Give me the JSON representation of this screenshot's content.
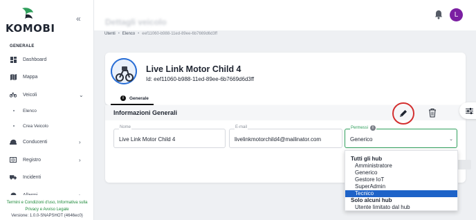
{
  "app": {
    "brand": "KOMOBI"
  },
  "sidebar": {
    "section_title": "GENERALE",
    "items": [
      {
        "label": "Dashboard",
        "icon": "dashboard-icon"
      },
      {
        "label": "Mappa",
        "icon": "map-icon"
      },
      {
        "label": "Veicoli",
        "icon": "bike-icon",
        "expanded": true
      },
      {
        "label": "Elenco",
        "sub": true
      },
      {
        "label": "Crea Veicolo",
        "sub": true
      },
      {
        "label": "Conducenti",
        "icon": "driver-icon"
      },
      {
        "label": "Registro",
        "icon": "register-icon"
      },
      {
        "label": "Incidenti",
        "icon": "truck-icon"
      },
      {
        "label": "Allarmi",
        "icon": "alarm-icon"
      }
    ],
    "footer_links": "Termini e Condizioni d'uso, Informativa sulla Privacy e Avviso Legale",
    "version": "Versione: 1.0.0-SNAPSHOT (4646ec0)"
  },
  "topbar": {
    "page_heading": "Dettagli veicolo",
    "avatar_initial": "L",
    "avatar_color": "#7b1fa2"
  },
  "breadcrumb": [
    "Utenti",
    "Elenco",
    "eef11060-b988-11ed-89ee-6b7669d6d3ff"
  ],
  "device": {
    "name": "Live Link Motor Child 4",
    "id_text": "Id: eef11060-b988-11ed-89ee-6b7669d6d3ff"
  },
  "tabs": [
    {
      "label": "Generale",
      "active": true
    }
  ],
  "info_section": {
    "title": "Informazioni Generali",
    "fields": {
      "nome": {
        "label": "Nome",
        "value": "Live Link Motor Child 4"
      },
      "email": {
        "label": "E-mail",
        "value": "livelinkmotorchild4@mailinator.com"
      },
      "permessi": {
        "label": "Permessi",
        "value": "Generico"
      }
    }
  },
  "permission_dropdown": {
    "groups": [
      {
        "label": "Tutti gli hub",
        "options": [
          "Amministratore",
          "Generico",
          "Gestore IoT",
          "SuperAdmin",
          "Tecnico"
        ]
      },
      {
        "label": "Solo alcuni hub",
        "options": [
          "Utente limitato dal hub"
        ]
      }
    ],
    "highlighted": "Tecnico"
  },
  "colors": {
    "brand_green": "#2e9e5a",
    "highlight_blue": "#1e63c8",
    "annotation_red": "#d32f2f"
  }
}
